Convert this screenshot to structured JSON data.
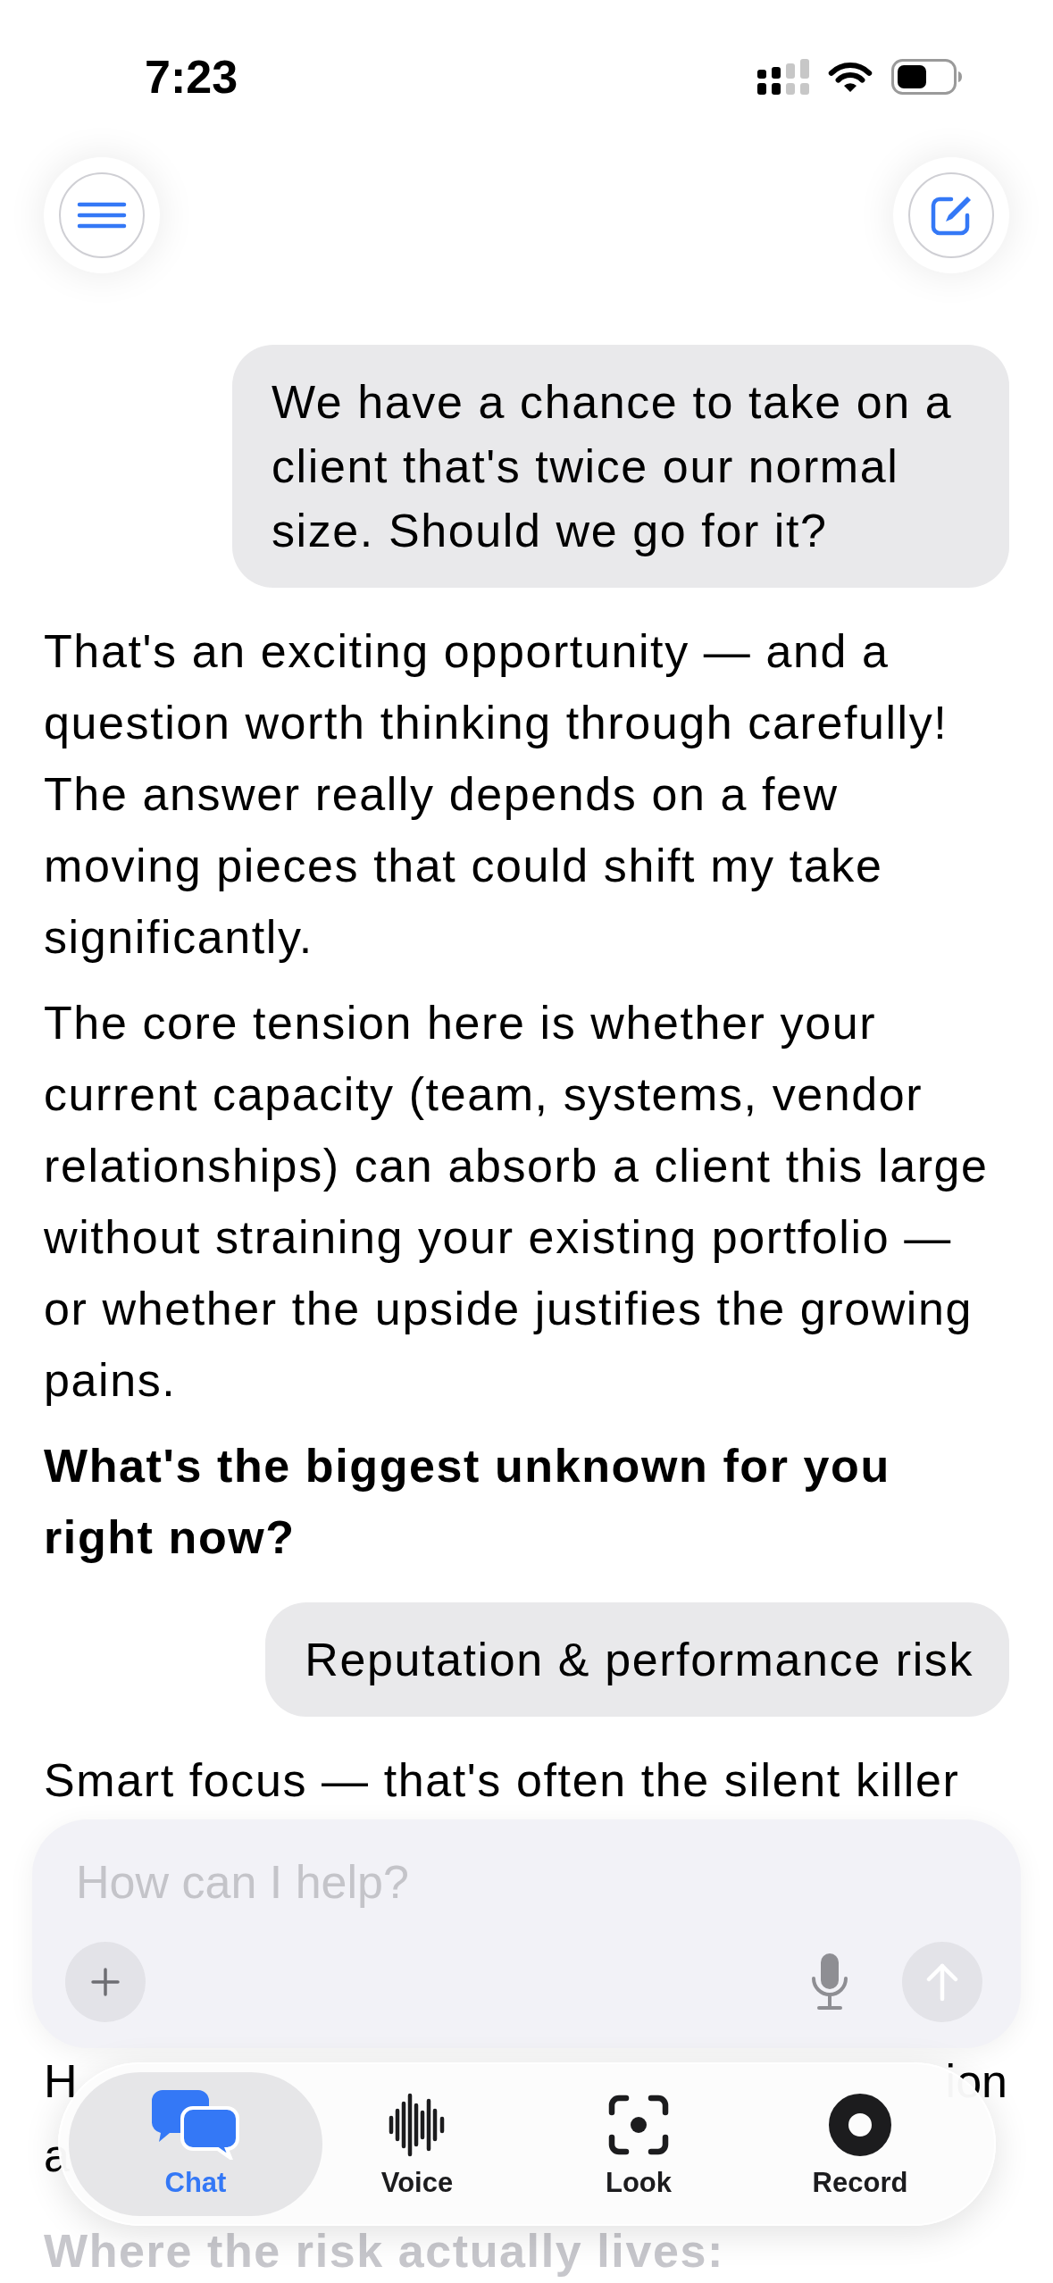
{
  "status_bar": {
    "time": "7:23"
  },
  "messages": [
    {
      "kind": "user",
      "text": "We have a chance to take on a client that's twice our normal size. Should we go for it?"
    },
    {
      "kind": "assistant",
      "paragraphs": [
        {
          "text": "That's an exciting opportunity — and a question worth thinking through carefully! The answer really depends on a few moving pieces that could shift my take significantly.",
          "bold": false
        },
        {
          "text": "The core tension here is whether your current capacity (team, systems, vendor relationships) can absorb a client this large without straining your existing portfolio — or whether the upside justifies the growing pains.",
          "bold": false
        },
        {
          "text": "What's the biggest unknown for you right now?",
          "bold": true
        }
      ]
    },
    {
      "kind": "user",
      "text": "Reputation & performance risk"
    },
    {
      "kind": "assistant",
      "paragraphs": [
        {
          "text": "Smart focus — that's often the silent killer",
          "bold": false
        }
      ]
    }
  ],
  "covered_text": {
    "lines": [
      {
        "start": "H",
        "end": "ion"
      },
      {
        "start": "a"
      }
    ],
    "faded_heading": "Where the risk actually lives:"
  },
  "composer": {
    "placeholder": "How can I help?"
  },
  "tab_bar": {
    "tabs": [
      {
        "label": "Chat",
        "selected": true
      },
      {
        "label": "Voice",
        "selected": false
      },
      {
        "label": "Look",
        "selected": false
      },
      {
        "label": "Record",
        "selected": false
      }
    ]
  }
}
